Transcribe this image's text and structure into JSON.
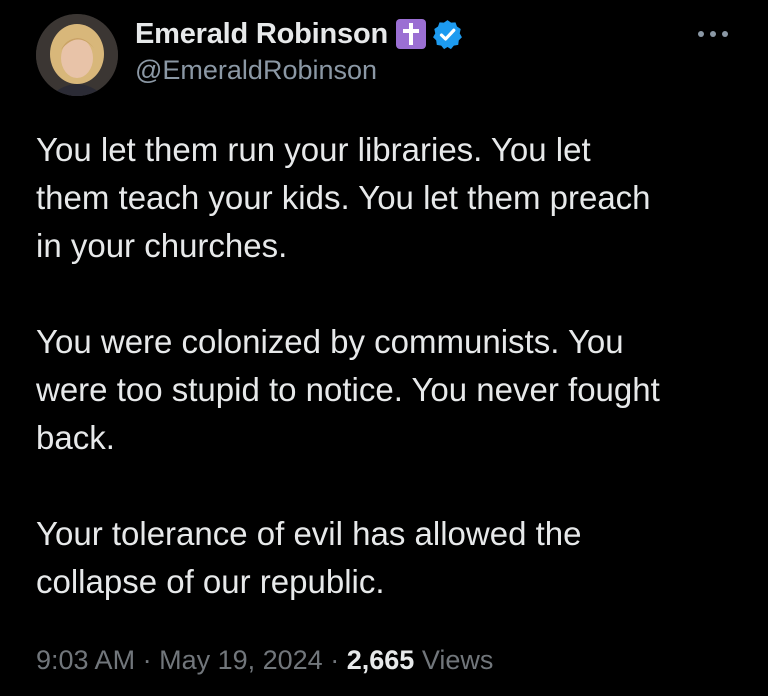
{
  "author": {
    "display_name": "Emerald Robinson",
    "handle": "@EmeraldRobinson",
    "badges": [
      "cross-badge",
      "verified-badge"
    ]
  },
  "tweet": {
    "paragraphs": [
      "You let them run your libraries. You let\nthem teach your kids. You let them preach\nin your churches.",
      "You were colonized by communists. You\nwere too stupid to notice. You never fought\nback.",
      "Your tolerance of evil has allowed the\ncollapse of our republic."
    ]
  },
  "meta": {
    "time": "9:03 AM",
    "separator": "·",
    "date": "May 19, 2024",
    "views_count": "2,665",
    "views_label": "Views"
  },
  "colors": {
    "background": "#000000",
    "text": "#e7e9ea",
    "secondary": "#8b98a5",
    "verified_blue": "#1d9bf0",
    "cross_badge": "#9b6fd3"
  }
}
